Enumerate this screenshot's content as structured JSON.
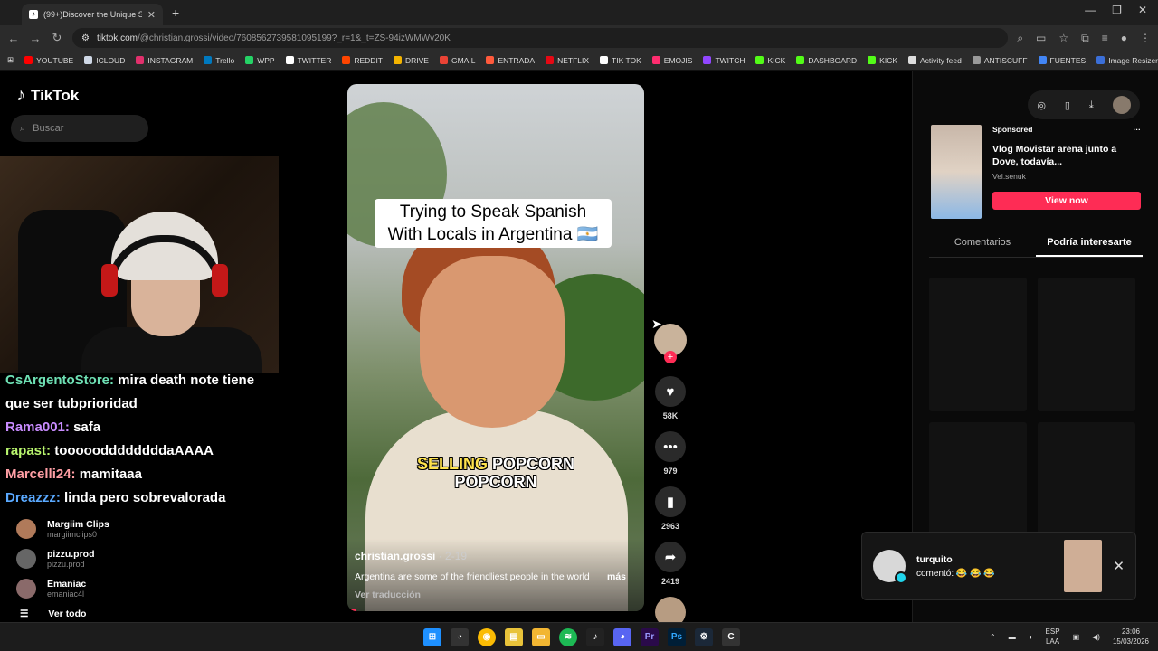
{
  "browser": {
    "tab_title": "(99+)Discover the Unique S",
    "url_host": "tiktok.com",
    "url_path": "/@christian.grossi/video/7608562739581095199?_r=1&_t=ZS-94izWMWv20K",
    "window_controls": [
      "—",
      "❐",
      "✕"
    ]
  },
  "bookmarks": [
    {
      "label": "YOUTUBE",
      "color": "#ff0000"
    },
    {
      "label": "ICLOUD",
      "color": "#cfd8e6"
    },
    {
      "label": "INSTAGRAM",
      "color": "#e1306c"
    },
    {
      "label": "Trello",
      "color": "#0079bf"
    },
    {
      "label": "WPP",
      "color": "#25d366"
    },
    {
      "label": "TWITTER",
      "color": "#ffffff"
    },
    {
      "label": "REDDIT",
      "color": "#ff4500"
    },
    {
      "label": "DRIVE",
      "color": "#f4b400"
    },
    {
      "label": "GMAIL",
      "color": "#ea4335"
    },
    {
      "label": "ENTRADA",
      "color": "#ff5a3c"
    },
    {
      "label": "NETFLIX",
      "color": "#e50914"
    },
    {
      "label": "TIK TOK",
      "color": "#ffffff"
    },
    {
      "label": "EMOJIS",
      "color": "#ff2d6f"
    },
    {
      "label": "TWITCH",
      "color": "#9146ff"
    },
    {
      "label": "KICK",
      "color": "#53fc18"
    },
    {
      "label": "DASHBOARD",
      "color": "#53fc18"
    },
    {
      "label": "KICK",
      "color": "#53fc18"
    },
    {
      "label": "Activity feed",
      "color": "#dddddd"
    },
    {
      "label": "ANTISCUFF",
      "color": "#999999"
    },
    {
      "label": "FUENTES",
      "color": "#4285f4"
    },
    {
      "label": "Image Resizer | Resi...",
      "color": "#3b6fd8"
    }
  ],
  "sidebar": {
    "logo": "TikTok",
    "search_placeholder": "Buscar",
    "accounts": [
      {
        "name": "Margiim Clips",
        "handle": "margiimclips0"
      },
      {
        "name": "pizzu.prod",
        "handle": "pizzu.prod"
      },
      {
        "name": "Emaniac",
        "handle": "emaniac4l"
      }
    ],
    "see_all": "Ver todo"
  },
  "chat": [
    {
      "user": "CsArgentoStore:",
      "msg": "mira death note tiene que ser tubprioridad"
    },
    {
      "user": "Rama001:",
      "msg": "safa"
    },
    {
      "user": "rapast:",
      "msg": "toooooddddddddaAAAA"
    },
    {
      "user": "Marcelli24:",
      "msg": "mamitaaa"
    },
    {
      "user": "Dreazzz:",
      "msg": "linda pero sobrevalorada"
    }
  ],
  "video": {
    "caption_line1": "Trying to Speak Spanish",
    "caption_line2": "With Locals in Argentina 🇦🇷",
    "subtitle_hl": "SELLING",
    "subtitle_rest": "POPCORN",
    "subtitle_line2": "POPCORN",
    "author": "christian.grossi",
    "date": "· 2-19",
    "description": "Argentina are some of the friendliest people in the world",
    "more": "más",
    "translate": "Ver traducción",
    "progress": 0.03
  },
  "actions": {
    "likes": "58K",
    "comments": "979",
    "saves": "2963",
    "shares": "2419"
  },
  "right_panel": {
    "sponsored": "Sponsored",
    "ad_title": "Vlog Movistar arena junto a Dove, todavía...",
    "ad_brand": "Vel.senuk",
    "ad_cta": "View now",
    "tab_comments": "Comentarios",
    "tab_suggested": "Podría interesarte"
  },
  "notification": {
    "user": "turquito",
    "text": "comentó: 😂 😂 😂"
  },
  "taskbar": {
    "lang_top": "ESP",
    "lang_bottom": "LAA",
    "time": "23:06",
    "date": "15/03/2026"
  }
}
